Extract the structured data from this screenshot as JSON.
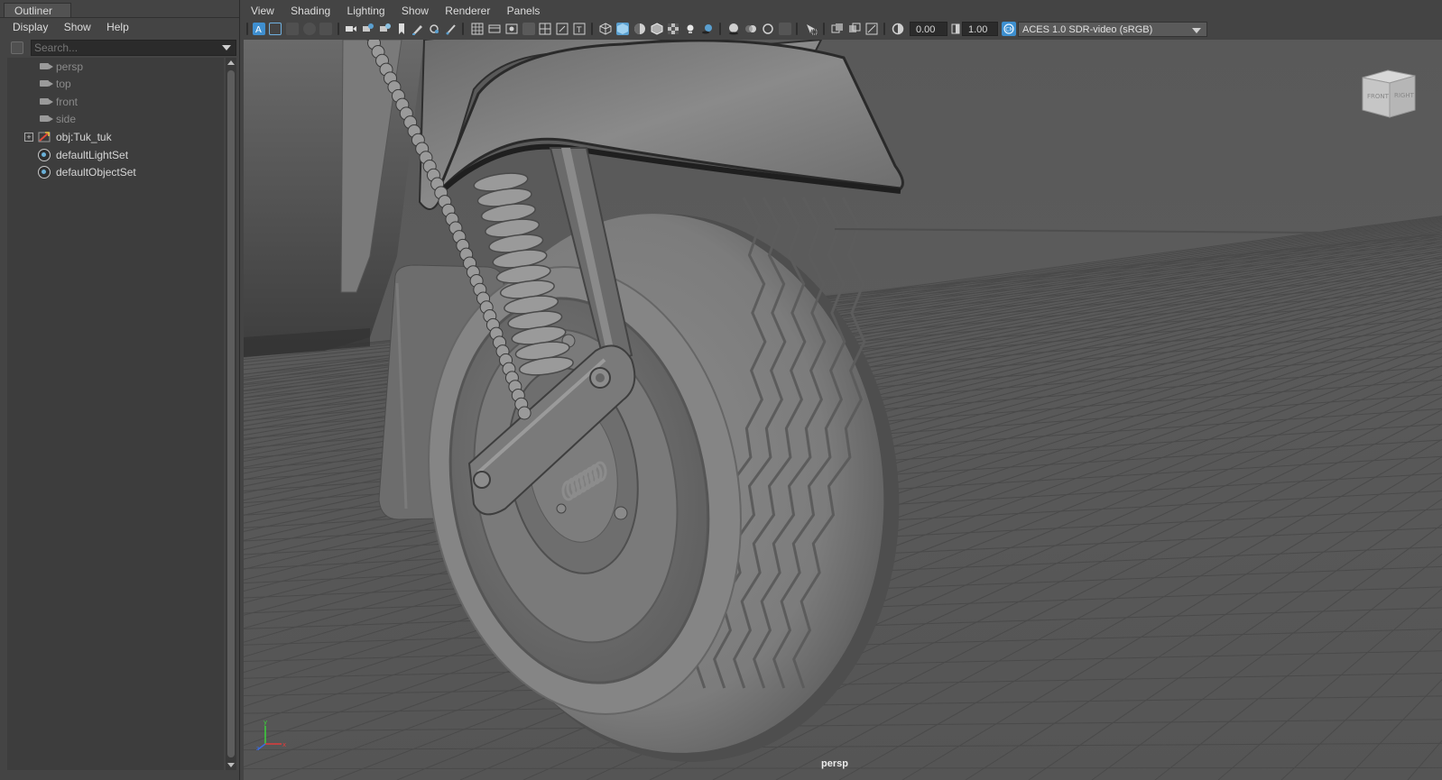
{
  "outliner": {
    "title": "Outliner",
    "menu": [
      "Display",
      "Show",
      "Help"
    ],
    "search_placeholder": "Search...",
    "items": [
      {
        "label": "persp",
        "icon": "camera-icon"
      },
      {
        "label": "top",
        "icon": "camera-icon"
      },
      {
        "label": "front",
        "icon": "camera-icon"
      },
      {
        "label": "side",
        "icon": "camera-icon"
      },
      {
        "label": "obj:Tuk_tuk",
        "icon": "transform-icon"
      },
      {
        "label": "defaultLightSet",
        "icon": "set-icon"
      },
      {
        "label": "defaultObjectSet",
        "icon": "set-icon"
      }
    ]
  },
  "panel": {
    "menu": [
      "View",
      "Shading",
      "Lighting",
      "Show",
      "Renderer",
      "Panels"
    ],
    "exposure": "0.00",
    "gamma": "1.00",
    "color_space": "ACES 1.0 SDR-video (sRGB)",
    "camera_label": "persp",
    "viewcube": {
      "front": "FRONT",
      "right": "RIGHT"
    }
  },
  "colors": {
    "ui_bg": "#444444",
    "accent": "#5a9fcf",
    "viewport_bg": "#5f5f5f"
  }
}
